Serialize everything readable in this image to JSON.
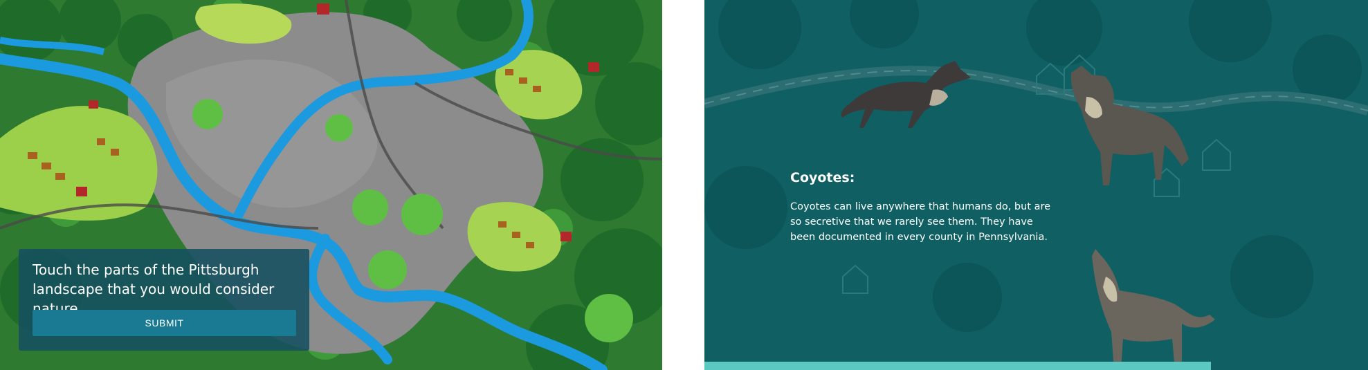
{
  "map_screen": {
    "prompt": "Touch the parts of the Pittsburgh landscape that you would consider nature.",
    "submit_label": "SUBMIT",
    "colors": {
      "panel": "#14505f",
      "button": "#1a7a93",
      "river": "#1a9be0",
      "forest": "#1f6b2a",
      "city": "#8a8a8a"
    }
  },
  "coyote_screen": {
    "title": "Coyotes:",
    "body": "Coyotes can live anywhere that humans do, but are so secretive that we rarely see them. They have been documented in every county in Pennsylvania.",
    "colors": {
      "background": "#0f5f63",
      "accent_bar": "#5cc8c2"
    }
  }
}
